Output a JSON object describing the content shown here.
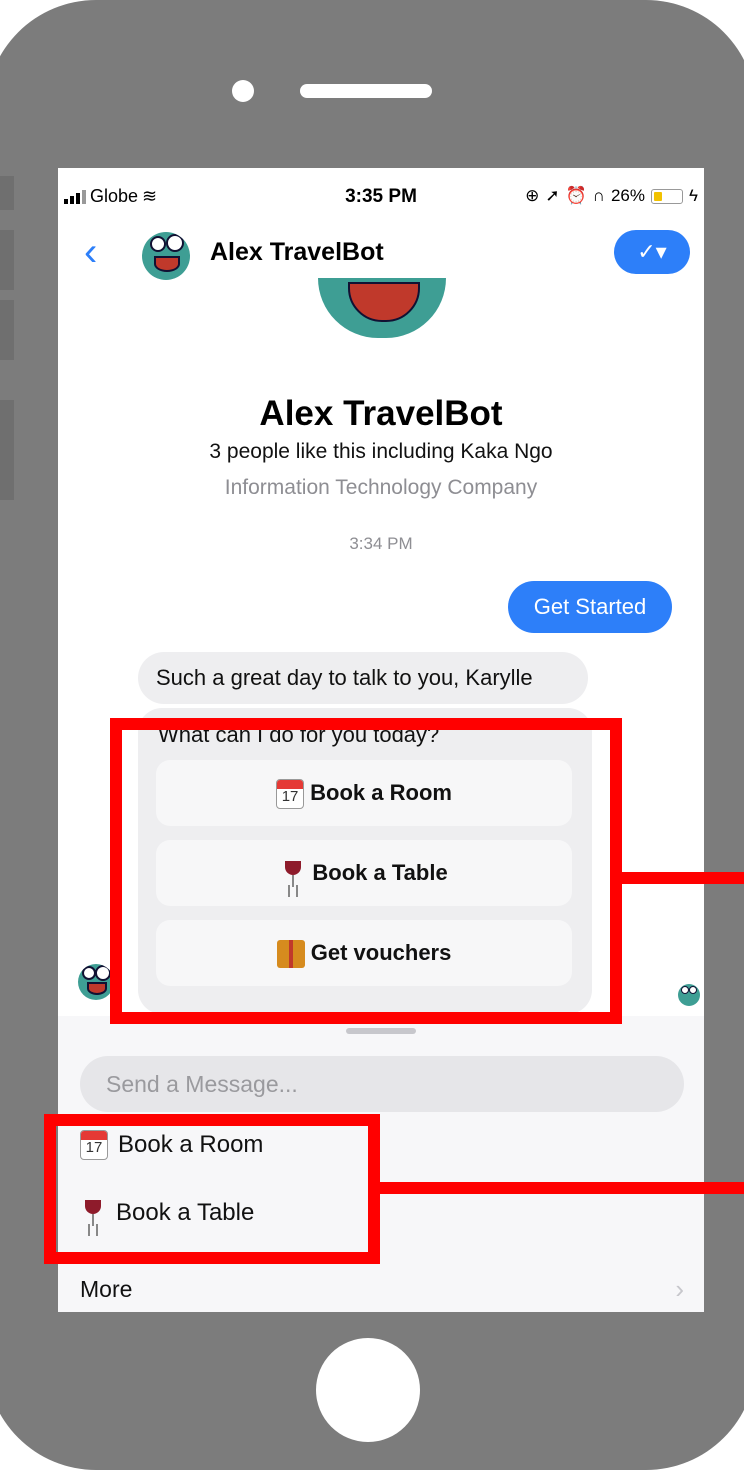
{
  "status_bar": {
    "carrier": "Globe",
    "time": "3:35 PM",
    "battery": "26%"
  },
  "header": {
    "back_icon": "chevron-left-icon",
    "title": "Alex TravelBot",
    "action_icon": "check-dropdown-icon"
  },
  "profile": {
    "name": "Alex TravelBot",
    "likes": "3 people like this including Kaka Ngo",
    "category": "Information Technology Company"
  },
  "conversation": {
    "timestamp": "3:34 PM",
    "outgoing": "Get Started",
    "greeting": "Such a great day to talk to you, Karylle",
    "prompt": "What can I do for you today?",
    "buttons": [
      {
        "icon": "calendar-icon",
        "label": "Book a Room"
      },
      {
        "icon": "wine-glass-icon",
        "label": "Book a Table"
      },
      {
        "icon": "gift-icon",
        "label": "Get vouchers"
      }
    ]
  },
  "composer": {
    "placeholder": "Send a Message...",
    "quick_replies": [
      {
        "icon": "calendar-icon",
        "label": "Book a Room"
      },
      {
        "icon": "wine-glass-icon",
        "label": "Book a Table"
      }
    ],
    "more_label": "More"
  },
  "colors": {
    "accent": "#2d7ff9",
    "annotation": "#ff0000",
    "device": "#7c7c7c"
  }
}
